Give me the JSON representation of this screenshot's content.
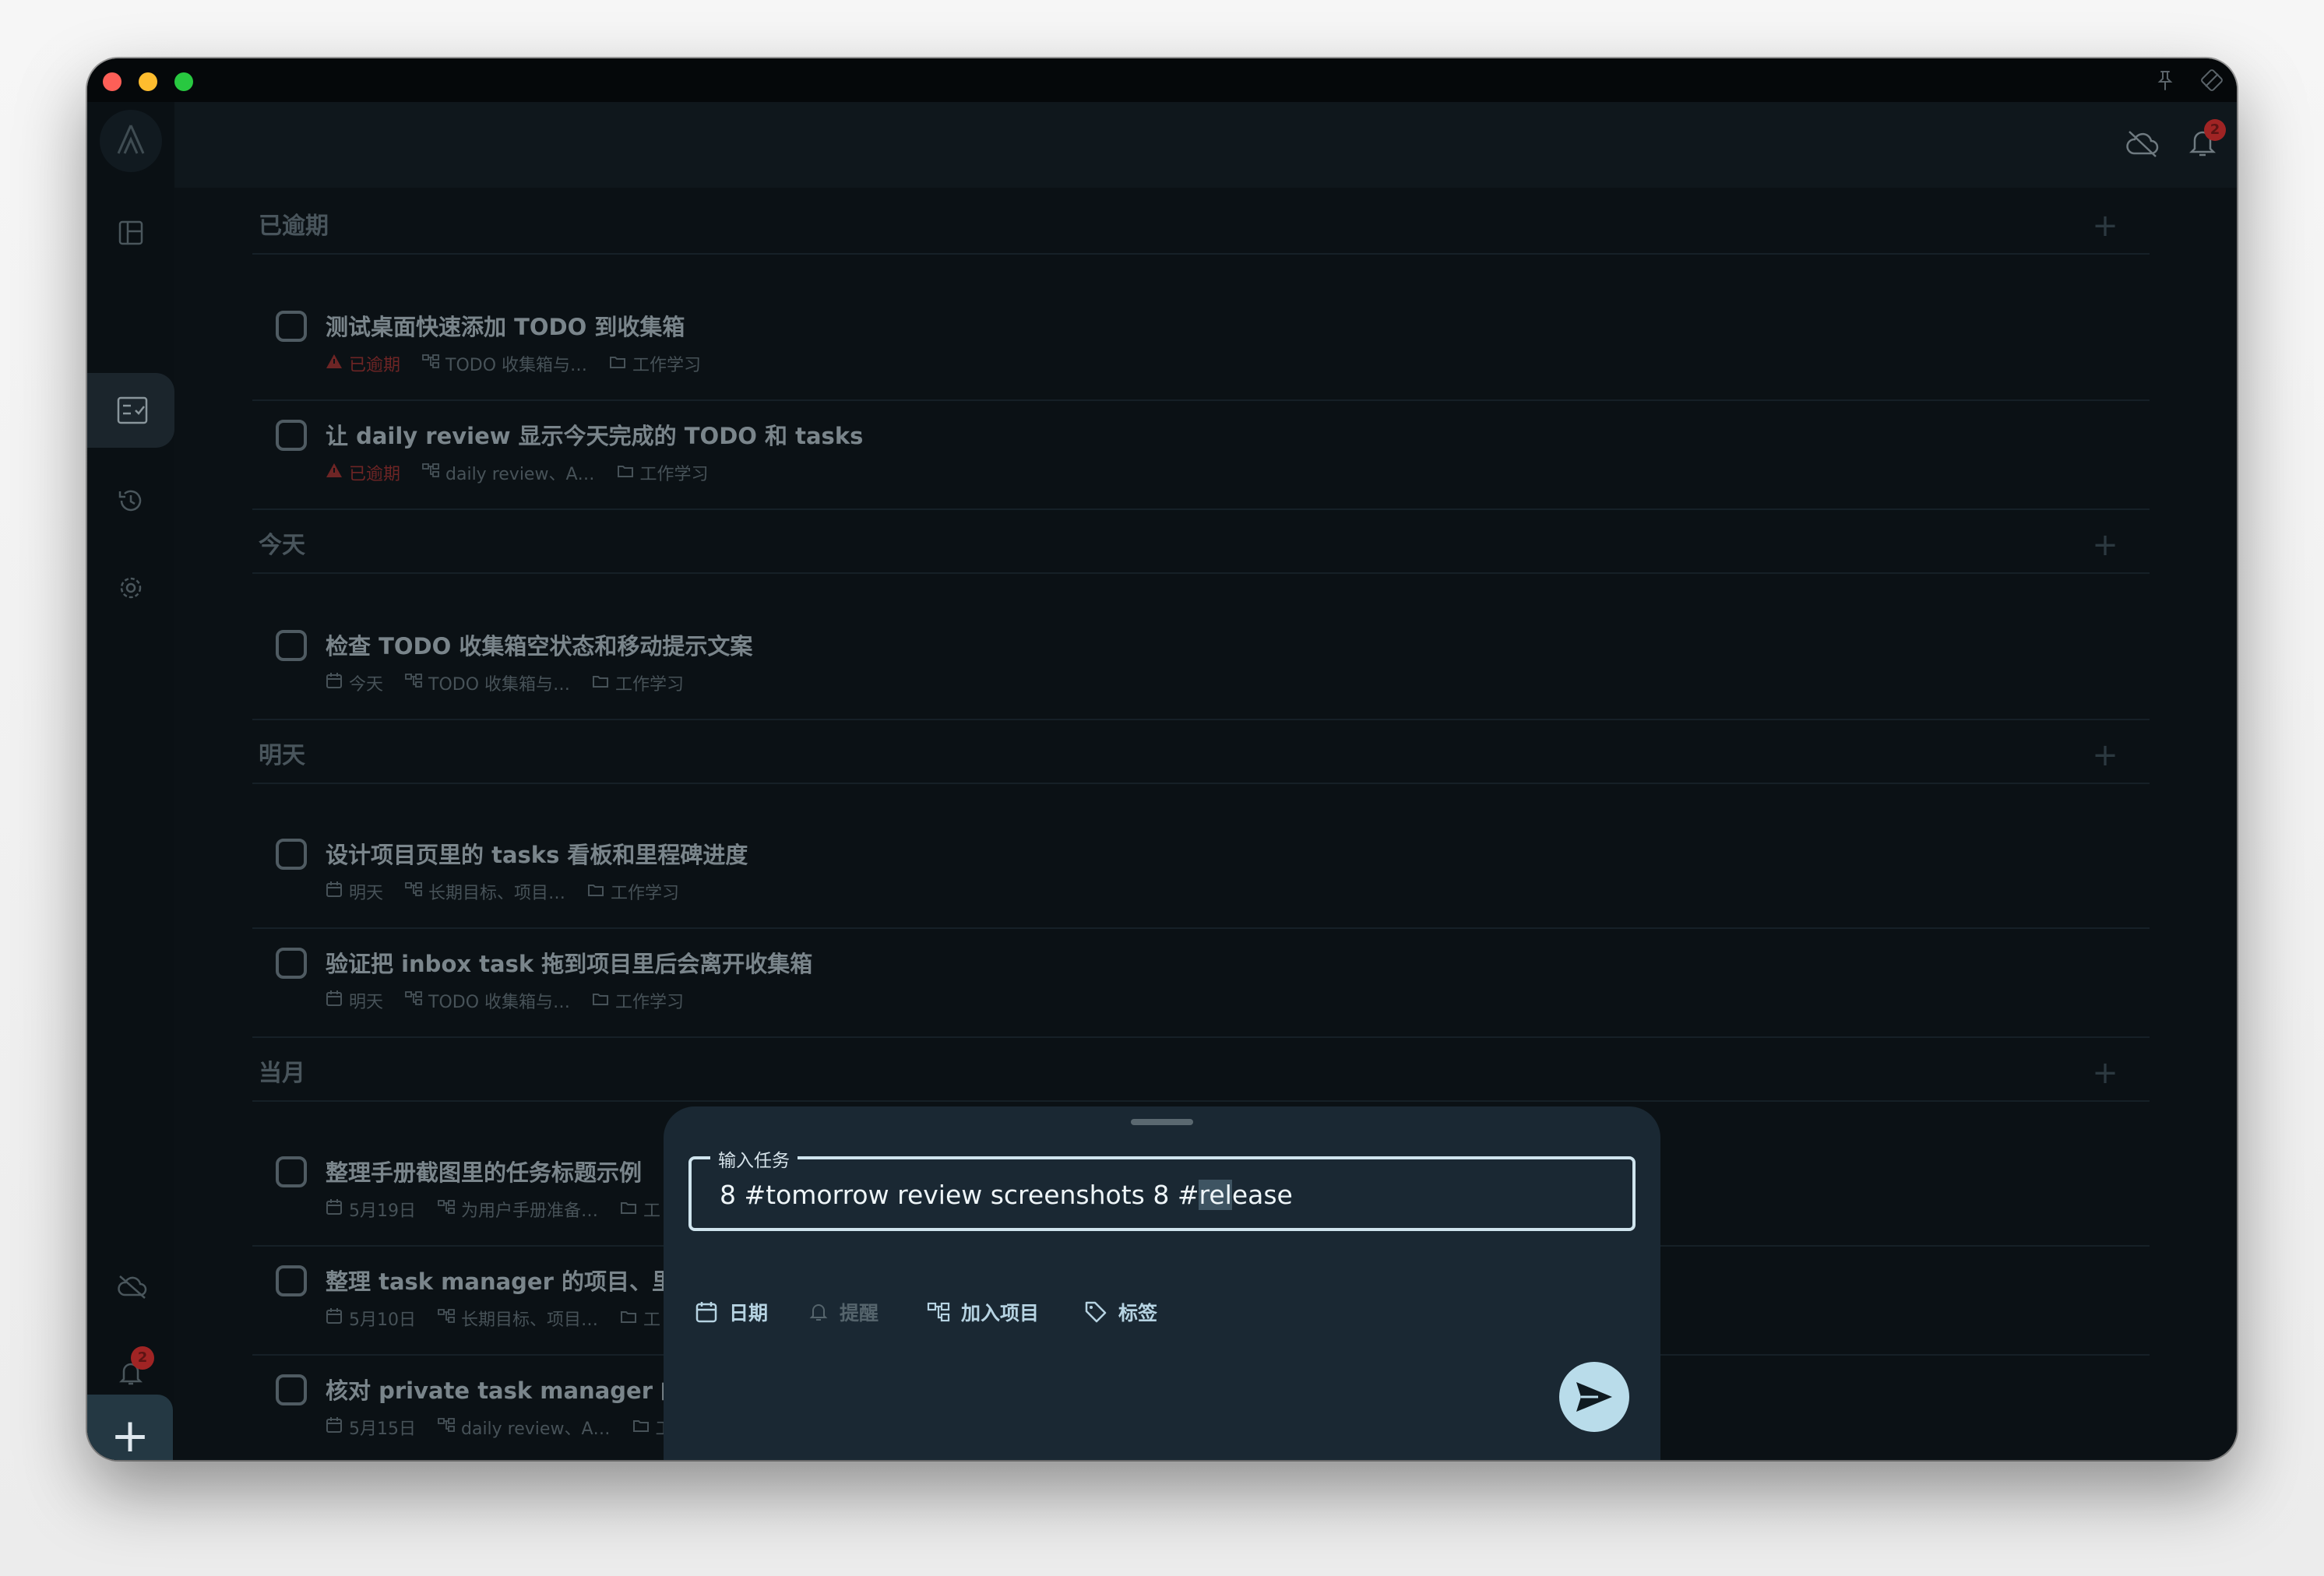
{
  "app": {
    "notification_count": "2"
  },
  "sections": [
    {
      "id": "overdue",
      "title": "已逾期",
      "tasks": [
        {
          "title": "测试桌面快速添加 TODO 到收集箱",
          "date": "已逾期",
          "date_overdue": true,
          "project": "TODO 收集箱与…",
          "tag": "工作学习"
        },
        {
          "title": "让 daily review 显示今天完成的 TODO 和 tasks",
          "date": "已逾期",
          "date_overdue": true,
          "project": "daily review、A…",
          "tag": "工作学习"
        }
      ]
    },
    {
      "id": "today",
      "title": "今天",
      "tasks": [
        {
          "title": "检查 TODO 收集箱空状态和移动提示文案",
          "date": "今天",
          "project": "TODO 收集箱与…",
          "tag": "工作学习"
        }
      ]
    },
    {
      "id": "tomorrow",
      "title": "明天",
      "tasks": [
        {
          "title": "设计项目页里的 tasks 看板和里程碑进度",
          "date": "明天",
          "project": "长期目标、项目…",
          "tag": "工作学习"
        },
        {
          "title": "验证把 inbox task 拖到项目里后会离开收集箱",
          "date": "明天",
          "project": "TODO 收集箱与…",
          "tag": "工作学习"
        }
      ]
    },
    {
      "id": "this-month",
      "title": "当月",
      "tasks": [
        {
          "title": "整理手册截图里的任务标题示例",
          "date": "5月19日",
          "project": "为用户手册准备…",
          "tag": "工"
        },
        {
          "title": "整理 task manager 的项目、里程碑",
          "date": "5月10日",
          "project": "长期目标、项目…",
          "tag": "工"
        },
        {
          "title": "核对 private task manager 的本地",
          "date": "5月15日",
          "project": "daily review、A…",
          "tag": "工"
        }
      ]
    }
  ],
  "quick_add": {
    "input_label": "输入任务",
    "input_text_before": "8 #tomorrow review screenshots 8 #",
    "input_text_selected": "rel",
    "input_text_after": "ease",
    "chips": {
      "date": "日期",
      "reminder": "提醒",
      "project": "加入项目",
      "tag": "标签"
    }
  },
  "colors": {
    "window_bg": "#0c1217",
    "sheet_bg": "#1a2833",
    "accent": "#b9dcea",
    "overdue": "#6e2525",
    "chip_active": "#b6d3e2",
    "chip_disabled": "#55646c"
  }
}
